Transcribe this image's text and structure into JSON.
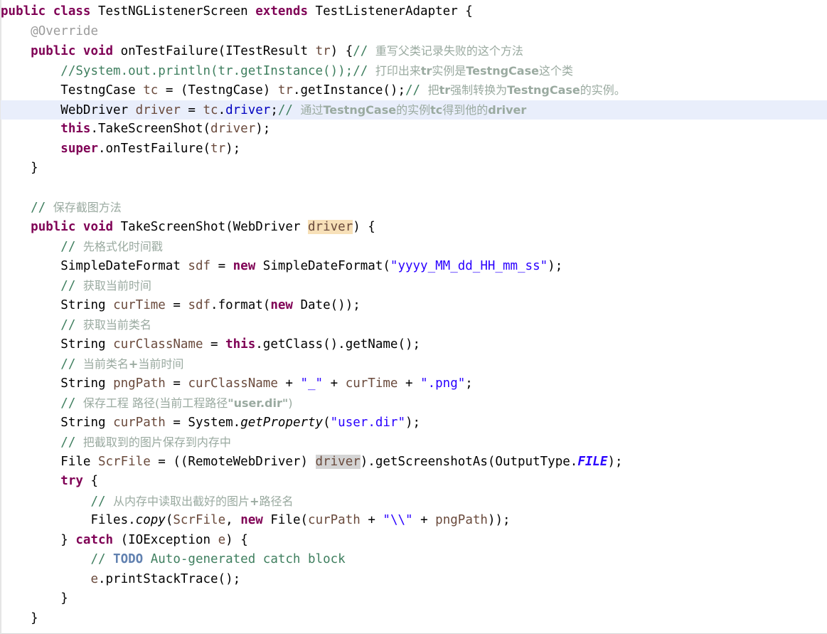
{
  "editor": {
    "language": "java",
    "theme": "eclipse-light",
    "background": "#ffffff",
    "current_line_highlight": "#e9eefb",
    "occurrence_highlight_param": "#f7e0b8",
    "occurrence_highlight_ref": "#d4d4d4",
    "keyword_color": "#7f0055",
    "comment_color": "#3f7f5f",
    "string_color": "#2a00ff",
    "field_color": "#0000c0",
    "local_var_color": "#6a4a3c",
    "annotation_color": "#9b9b9b",
    "todo_color": "#6181b0",
    "current_line_index": 4
  },
  "lines": [
    {
      "n": 0,
      "indent": 0,
      "tokens": [
        {
          "t": "public",
          "c": "kw"
        },
        {
          "t": " ",
          "c": "plain"
        },
        {
          "t": "class",
          "c": "kw"
        },
        {
          "t": " TestNGListenerScreen ",
          "c": "plain"
        },
        {
          "t": "extends",
          "c": "kw"
        },
        {
          "t": " TestListenerAdapter {",
          "c": "plain"
        }
      ]
    },
    {
      "n": 1,
      "indent": 1,
      "tokens": [
        {
          "t": "@Override",
          "c": "ann"
        }
      ]
    },
    {
      "n": 2,
      "indent": 1,
      "tokens": [
        {
          "t": "public",
          "c": "kw"
        },
        {
          "t": " ",
          "c": "plain"
        },
        {
          "t": "void",
          "c": "kw"
        },
        {
          "t": " onTestFailure(ITestResult ",
          "c": "plain"
        },
        {
          "t": "tr",
          "c": "var"
        },
        {
          "t": ") {",
          "c": "plain"
        },
        {
          "t": "// ",
          "c": "cmt"
        },
        {
          "t": "重写父类记录失败的这个方法",
          "c": "cmt-cn"
        }
      ]
    },
    {
      "n": 3,
      "indent": 2,
      "tokens": [
        {
          "t": "//System.out.println(tr.getInstance());",
          "c": "cmt"
        },
        {
          "t": "// ",
          "c": "cmt"
        },
        {
          "t": "打印出来",
          "c": "cmt-cn"
        },
        {
          "t": "tr",
          "c": "cmt-cn-b"
        },
        {
          "t": "实例是",
          "c": "cmt-cn"
        },
        {
          "t": "TestngCase",
          "c": "cmt-cn-b"
        },
        {
          "t": "这个类",
          "c": "cmt-cn"
        }
      ]
    },
    {
      "n": 4,
      "indent": 2,
      "tokens": [
        {
          "t": "TestngCase ",
          "c": "plain"
        },
        {
          "t": "tc",
          "c": "var"
        },
        {
          "t": " = (TestngCase) ",
          "c": "plain"
        },
        {
          "t": "tr",
          "c": "var"
        },
        {
          "t": ".getInstance();",
          "c": "plain"
        },
        {
          "t": "// ",
          "c": "cmt"
        },
        {
          "t": "把",
          "c": "cmt-cn"
        },
        {
          "t": "tr",
          "c": "cmt-cn-b"
        },
        {
          "t": "强制转换为",
          "c": "cmt-cn"
        },
        {
          "t": "TestngCase",
          "c": "cmt-cn-b"
        },
        {
          "t": "的实例。",
          "c": "cmt-cn"
        }
      ]
    },
    {
      "n": 5,
      "indent": 2,
      "current": true,
      "tokens": [
        {
          "t": "WebDriver ",
          "c": "plain"
        },
        {
          "t": "driver",
          "c": "var"
        },
        {
          "t": " = ",
          "c": "plain"
        },
        {
          "t": "tc",
          "c": "var"
        },
        {
          "t": ".",
          "c": "plain"
        },
        {
          "t": "driver",
          "c": "fld"
        },
        {
          "t": ";",
          "c": "plain"
        },
        {
          "t": "// ",
          "c": "cmt"
        },
        {
          "t": "通过",
          "c": "cmt-cn"
        },
        {
          "t": "TestngCase",
          "c": "cmt-cn-b"
        },
        {
          "t": "的实例",
          "c": "cmt-cn"
        },
        {
          "t": "tc",
          "c": "cmt-cn-b"
        },
        {
          "t": "得到他的",
          "c": "cmt-cn"
        },
        {
          "t": "driver",
          "c": "cmt-cn-b"
        }
      ]
    },
    {
      "n": 6,
      "indent": 2,
      "tokens": [
        {
          "t": "this",
          "c": "kw"
        },
        {
          "t": ".TakeScreenShot(",
          "c": "plain"
        },
        {
          "t": "driver",
          "c": "var"
        },
        {
          "t": ");",
          "c": "plain"
        }
      ]
    },
    {
      "n": 7,
      "indent": 2,
      "tokens": [
        {
          "t": "super",
          "c": "kw"
        },
        {
          "t": ".onTestFailure(",
          "c": "plain"
        },
        {
          "t": "tr",
          "c": "var"
        },
        {
          "t": ");",
          "c": "plain"
        }
      ]
    },
    {
      "n": 8,
      "indent": 1,
      "tokens": [
        {
          "t": "}",
          "c": "plain"
        }
      ]
    },
    {
      "n": 9,
      "indent": 0,
      "tokens": []
    },
    {
      "n": 10,
      "indent": 1,
      "tokens": [
        {
          "t": "// ",
          "c": "cmt"
        },
        {
          "t": "保存截图方法",
          "c": "cmt-cn"
        }
      ]
    },
    {
      "n": 11,
      "indent": 1,
      "tokens": [
        {
          "t": "public",
          "c": "kw"
        },
        {
          "t": " ",
          "c": "plain"
        },
        {
          "t": "void",
          "c": "kw"
        },
        {
          "t": " TakeScreenShot(WebDriver ",
          "c": "plain"
        },
        {
          "t": "driver",
          "c": "var hl-occ"
        },
        {
          "t": ") {",
          "c": "plain"
        }
      ]
    },
    {
      "n": 12,
      "indent": 2,
      "tokens": [
        {
          "t": "// ",
          "c": "cmt"
        },
        {
          "t": "先格式化时间戳",
          "c": "cmt-cn"
        }
      ]
    },
    {
      "n": 13,
      "indent": 2,
      "tokens": [
        {
          "t": "SimpleDateFormat ",
          "c": "plain"
        },
        {
          "t": "sdf",
          "c": "var"
        },
        {
          "t": " = ",
          "c": "plain"
        },
        {
          "t": "new",
          "c": "kw"
        },
        {
          "t": " SimpleDateFormat(",
          "c": "plain"
        },
        {
          "t": "\"yyyy_MM_dd_HH_mm_ss\"",
          "c": "str"
        },
        {
          "t": ");",
          "c": "plain"
        }
      ]
    },
    {
      "n": 14,
      "indent": 2,
      "tokens": [
        {
          "t": "// ",
          "c": "cmt"
        },
        {
          "t": "获取当前时间",
          "c": "cmt-cn"
        }
      ]
    },
    {
      "n": 15,
      "indent": 2,
      "tokens": [
        {
          "t": "String ",
          "c": "plain"
        },
        {
          "t": "curTime",
          "c": "var"
        },
        {
          "t": " = ",
          "c": "plain"
        },
        {
          "t": "sdf",
          "c": "var"
        },
        {
          "t": ".format(",
          "c": "plain"
        },
        {
          "t": "new",
          "c": "kw"
        },
        {
          "t": " Date());",
          "c": "plain"
        }
      ]
    },
    {
      "n": 16,
      "indent": 2,
      "tokens": [
        {
          "t": "// ",
          "c": "cmt"
        },
        {
          "t": "获取当前类名",
          "c": "cmt-cn"
        }
      ]
    },
    {
      "n": 17,
      "indent": 2,
      "tokens": [
        {
          "t": "String ",
          "c": "plain"
        },
        {
          "t": "curClassName",
          "c": "var"
        },
        {
          "t": " = ",
          "c": "plain"
        },
        {
          "t": "this",
          "c": "kw"
        },
        {
          "t": ".getClass().getName();",
          "c": "plain"
        }
      ]
    },
    {
      "n": 18,
      "indent": 2,
      "tokens": [
        {
          "t": "// ",
          "c": "cmt"
        },
        {
          "t": "当前类名",
          "c": "cmt-cn"
        },
        {
          "t": "+",
          "c": "cmt-cn-b"
        },
        {
          "t": "当前时间",
          "c": "cmt-cn"
        }
      ]
    },
    {
      "n": 19,
      "indent": 2,
      "tokens": [
        {
          "t": "String ",
          "c": "plain"
        },
        {
          "t": "pngPath",
          "c": "var"
        },
        {
          "t": " = ",
          "c": "plain"
        },
        {
          "t": "curClassName",
          "c": "var"
        },
        {
          "t": " + ",
          "c": "plain"
        },
        {
          "t": "\"_\"",
          "c": "str"
        },
        {
          "t": " + ",
          "c": "plain"
        },
        {
          "t": "curTime",
          "c": "var"
        },
        {
          "t": " + ",
          "c": "plain"
        },
        {
          "t": "\".png\"",
          "c": "str"
        },
        {
          "t": ";",
          "c": "plain"
        }
      ]
    },
    {
      "n": 20,
      "indent": 2,
      "tokens": [
        {
          "t": "// ",
          "c": "cmt"
        },
        {
          "t": "保存工程 路径(当前工程路径",
          "c": "cmt-cn"
        },
        {
          "t": "\"user.dir\"",
          "c": "cmt-cn-b"
        },
        {
          "t": ")",
          "c": "cmt-cn"
        }
      ]
    },
    {
      "n": 21,
      "indent": 2,
      "tokens": [
        {
          "t": "String ",
          "c": "plain"
        },
        {
          "t": "curPath",
          "c": "var"
        },
        {
          "t": " = System.",
          "c": "plain"
        },
        {
          "t": "getProperty",
          "c": "stat"
        },
        {
          "t": "(",
          "c": "plain"
        },
        {
          "t": "\"user.dir\"",
          "c": "str"
        },
        {
          "t": ");",
          "c": "plain"
        }
      ]
    },
    {
      "n": 22,
      "indent": 2,
      "tokens": [
        {
          "t": "// ",
          "c": "cmt"
        },
        {
          "t": "把截取到的图片保存到内存中",
          "c": "cmt-cn"
        }
      ]
    },
    {
      "n": 23,
      "indent": 2,
      "tokens": [
        {
          "t": "File ",
          "c": "plain"
        },
        {
          "t": "ScrFile",
          "c": "var"
        },
        {
          "t": " = ((RemoteWebDriver) ",
          "c": "plain"
        },
        {
          "t": "driver",
          "c": "var hl-occ2"
        },
        {
          "t": ").getScreenshotAs(OutputType.",
          "c": "plain"
        },
        {
          "t": "FILE",
          "c": "statf"
        },
        {
          "t": ");",
          "c": "plain"
        }
      ]
    },
    {
      "n": 24,
      "indent": 2,
      "tokens": [
        {
          "t": "try",
          "c": "kw"
        },
        {
          "t": " {",
          "c": "plain"
        }
      ]
    },
    {
      "n": 25,
      "indent": 3,
      "tokens": [
        {
          "t": "// ",
          "c": "cmt"
        },
        {
          "t": "从内存中读取出截好的图片",
          "c": "cmt-cn"
        },
        {
          "t": "+",
          "c": "cmt-cn-b"
        },
        {
          "t": "路径名",
          "c": "cmt-cn"
        }
      ]
    },
    {
      "n": 26,
      "indent": 3,
      "tokens": [
        {
          "t": "Files.",
          "c": "plain"
        },
        {
          "t": "copy",
          "c": "stat"
        },
        {
          "t": "(",
          "c": "plain"
        },
        {
          "t": "ScrFile",
          "c": "var"
        },
        {
          "t": ", ",
          "c": "plain"
        },
        {
          "t": "new",
          "c": "kw"
        },
        {
          "t": " File(",
          "c": "plain"
        },
        {
          "t": "curPath",
          "c": "var"
        },
        {
          "t": " + ",
          "c": "plain"
        },
        {
          "t": "\"\\\\\"",
          "c": "str"
        },
        {
          "t": " + ",
          "c": "plain"
        },
        {
          "t": "pngPath",
          "c": "var"
        },
        {
          "t": "));",
          "c": "plain"
        }
      ]
    },
    {
      "n": 27,
      "indent": 2,
      "tokens": [
        {
          "t": "} ",
          "c": "plain"
        },
        {
          "t": "catch",
          "c": "kw"
        },
        {
          "t": " (IOException ",
          "c": "plain"
        },
        {
          "t": "e",
          "c": "var"
        },
        {
          "t": ") {",
          "c": "plain"
        }
      ]
    },
    {
      "n": 28,
      "indent": 3,
      "tokens": [
        {
          "t": "// ",
          "c": "cmt"
        },
        {
          "t": "TODO",
          "c": "todo"
        },
        {
          "t": " Auto-generated catch block",
          "c": "cmt"
        }
      ]
    },
    {
      "n": 29,
      "indent": 3,
      "tokens": [
        {
          "t": "e",
          "c": "var"
        },
        {
          "t": ".printStackTrace();",
          "c": "plain"
        }
      ]
    },
    {
      "n": 30,
      "indent": 2,
      "tokens": [
        {
          "t": "}",
          "c": "plain"
        }
      ]
    },
    {
      "n": 31,
      "indent": 1,
      "tokens": [
        {
          "t": "}",
          "c": "plain"
        }
      ]
    }
  ]
}
